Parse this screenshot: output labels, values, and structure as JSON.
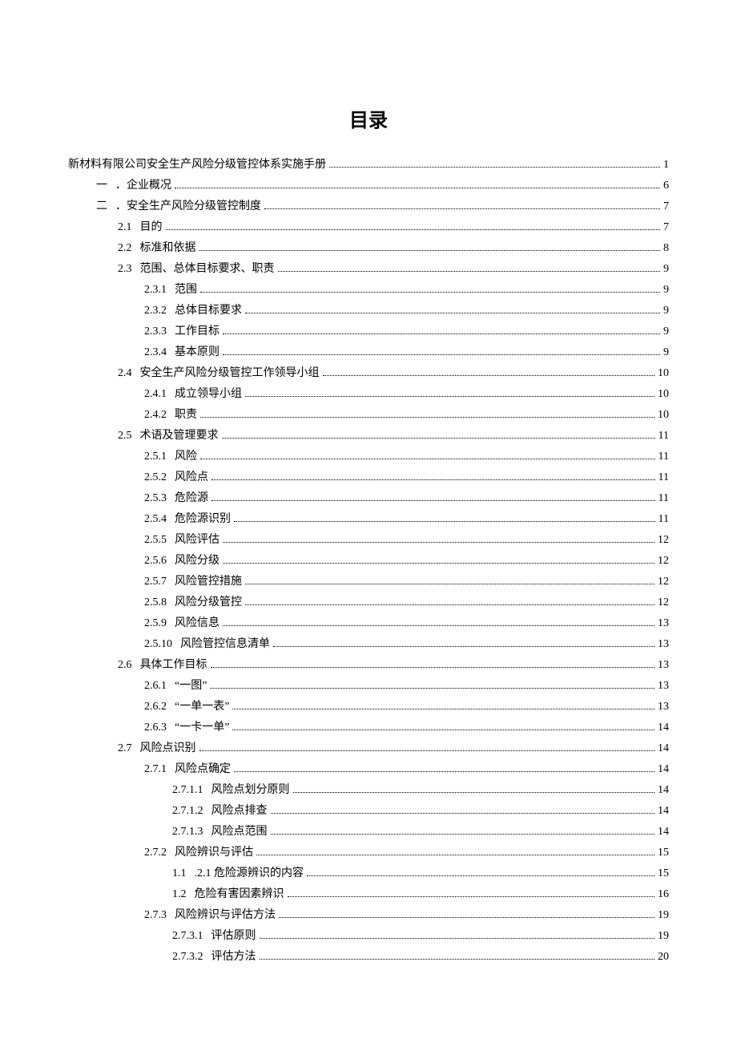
{
  "title": "目录",
  "toc": [
    {
      "indent": 0,
      "num": "",
      "label": "新材料有限公司安全生产风险分级管控体系实施手册",
      "page": "1"
    },
    {
      "indent": 1,
      "num": "一",
      "label": "．企业概况",
      "page": "6"
    },
    {
      "indent": 1,
      "num": "二",
      "label": "．安全生产风险分级管控制度",
      "page": "7"
    },
    {
      "indent": 2,
      "num": "2.1",
      "label": "目的",
      "page": "7"
    },
    {
      "indent": 2,
      "num": "2.2",
      "label": "标准和依据",
      "page": "8"
    },
    {
      "indent": 2,
      "num": "2.3",
      "label": "范围、总体目标要求、职责",
      "page": "9"
    },
    {
      "indent": 3,
      "num": "2.3.1",
      "label": "范围",
      "page": "9"
    },
    {
      "indent": 3,
      "num": "2.3.2",
      "label": "总体目标要求",
      "page": "9"
    },
    {
      "indent": 3,
      "num": "2.3.3",
      "label": "工作目标",
      "page": "9"
    },
    {
      "indent": 3,
      "num": "2.3.4",
      "label": "基本原则",
      "page": "9"
    },
    {
      "indent": 2,
      "num": "2.4",
      "label": "安全生产风险分级管控工作领导小组",
      "page": "10"
    },
    {
      "indent": 3,
      "num": "2.4.1",
      "label": "成立领导小组",
      "page": "10"
    },
    {
      "indent": 3,
      "num": "2.4.2",
      "label": "职责",
      "page": "10"
    },
    {
      "indent": 2,
      "num": "2.5",
      "label": "术语及管理要求",
      "page": "11"
    },
    {
      "indent": 3,
      "num": "2.5.1",
      "label": "风险",
      "page": "11"
    },
    {
      "indent": 3,
      "num": "2.5.2",
      "label": "风险点",
      "page": "11"
    },
    {
      "indent": 3,
      "num": "2.5.3",
      "label": "危险源",
      "page": "11"
    },
    {
      "indent": 3,
      "num": "2.5.4",
      "label": "危险源识别",
      "page": "11"
    },
    {
      "indent": 3,
      "num": "2.5.5",
      "label": "风险评估",
      "page": "12"
    },
    {
      "indent": 3,
      "num": "2.5.6",
      "label": "风险分级",
      "page": "12"
    },
    {
      "indent": 3,
      "num": "2.5.7",
      "label": "风险管控措施",
      "page": "12"
    },
    {
      "indent": 3,
      "num": "2.5.8",
      "label": "风险分级管控",
      "page": "12"
    },
    {
      "indent": 3,
      "num": "2.5.9",
      "label": "风险信息",
      "page": "13"
    },
    {
      "indent": 3,
      "num": "2.5.10",
      "label": "风险管控信息清单",
      "page": "13"
    },
    {
      "indent": 2,
      "num": "2.6",
      "label": "具体工作目标",
      "page": "13"
    },
    {
      "indent": 3,
      "num": "2.6.1",
      "label": "“一图”",
      "page": "13"
    },
    {
      "indent": 3,
      "num": "2.6.2",
      "label": "“一单一表”",
      "page": "13"
    },
    {
      "indent": 3,
      "num": "2.6.3",
      "label": "“一卡一单”",
      "page": "14"
    },
    {
      "indent": 2,
      "num": "2.7",
      "label": "风险点识别",
      "page": "14"
    },
    {
      "indent": 3,
      "num": "2.7.1",
      "label": "风险点确定",
      "page": "14"
    },
    {
      "indent": 4,
      "num": "2.7.1.1",
      "label": "风险点划分原则",
      "page": "14"
    },
    {
      "indent": 4,
      "num": "2.7.1.2",
      "label": "风险点排查",
      "page": "14"
    },
    {
      "indent": 4,
      "num": "2.7.1.3",
      "label": "风险点范围",
      "page": "14"
    },
    {
      "indent": 3,
      "num": "2.7.2",
      "label": "风险辨识与评估",
      "page": "15"
    },
    {
      "indent": 4,
      "num": "1.1",
      "label": ".2.1 危险源辨识的内容",
      "page": "15"
    },
    {
      "indent": 4,
      "num": "1.2",
      "label": "危险有害因素辨识",
      "page": "16"
    },
    {
      "indent": 3,
      "num": "2.7.3",
      "label": "风险辨识与评估方法",
      "page": "19"
    },
    {
      "indent": 4,
      "num": "2.7.3.1",
      "label": "评估原则",
      "page": "19"
    },
    {
      "indent": 4,
      "num": "2.7.3.2",
      "label": "评估方法",
      "page": "20"
    }
  ]
}
